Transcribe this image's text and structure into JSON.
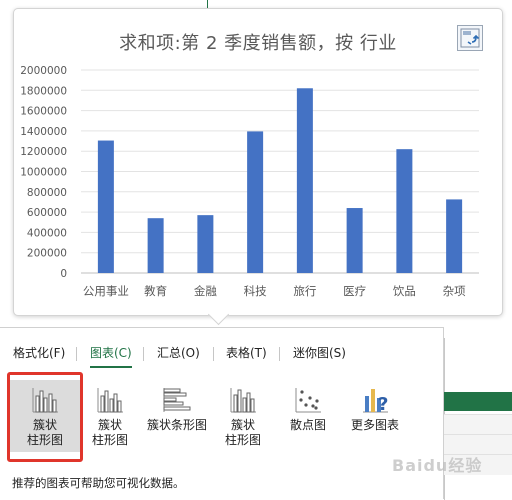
{
  "chart_data": {
    "type": "bar",
    "title": "求和项:第 2 季度销售额，按 行业",
    "categories": [
      "公用事业",
      "教育",
      "金融",
      "科技",
      "旅行",
      "医疗",
      "饮品",
      "杂项"
    ],
    "values": [
      1305000,
      540000,
      570000,
      1395000,
      1820000,
      640000,
      1220000,
      725000
    ],
    "ylim": [
      0,
      2000000
    ],
    "yticks": [
      "0",
      "200000",
      "400000",
      "600000",
      "800000",
      "1000000",
      "1200000",
      "1400000",
      "1600000",
      "1800000",
      "2000000"
    ],
    "grid": true,
    "bar_color": "#4472c4"
  },
  "panel": {
    "tabs": [
      "格式化(F)",
      "图表(C)",
      "汇总(O)",
      "表格(T)",
      "迷你图(S)"
    ],
    "active_tab": "图表(C)",
    "options": [
      {
        "label_line1": "簇状",
        "label_line2": "柱形图",
        "icon": "clustered-column-chart-icon",
        "selected": true
      },
      {
        "label_line1": "簇状",
        "label_line2": "柱形图",
        "icon": "clustered-column-chart-icon"
      },
      {
        "label_line1": "簇状条形图",
        "label_line2": "",
        "icon": "clustered-bar-chart-icon"
      },
      {
        "label_line1": "簇状",
        "label_line2": "柱形图",
        "icon": "clustered-column-chart-icon"
      },
      {
        "label_line1": "散点图",
        "label_line2": "",
        "icon": "scatter-chart-icon"
      },
      {
        "label_line1": "更多图表",
        "label_line2": "",
        "icon": "more-charts-icon"
      }
    ],
    "footer": "推荐的图表可帮助您可视化数据。"
  },
  "watermark": "Baidu经验",
  "colors": {
    "accent": "#217346",
    "highlight": "#e0352b",
    "bar": "#4472c4"
  }
}
